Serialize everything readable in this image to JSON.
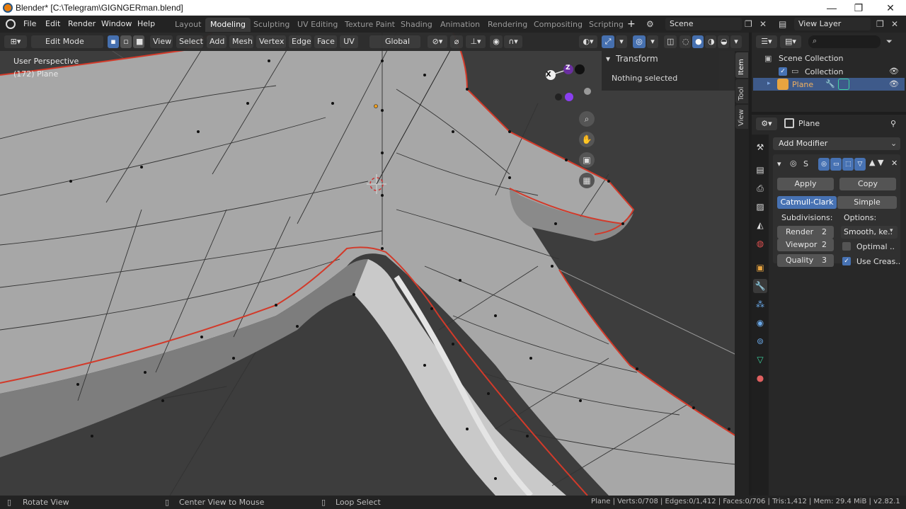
{
  "window": {
    "title": "Blender* [C:\\Telegram\\GIGNGERman.blend]",
    "minimize": "—",
    "maximize": "❐",
    "close": "✕"
  },
  "menu": [
    "File",
    "Edit",
    "Render",
    "Window",
    "Help"
  ],
  "workspaces": {
    "tabs": [
      "Layout",
      "Modeling",
      "Sculpting",
      "UV Editing",
      "Texture Paint",
      "Shading",
      "Animation",
      "Rendering",
      "Compositing",
      "Scripting"
    ],
    "active": "Modeling",
    "add": "+"
  },
  "scene": {
    "label": "Scene",
    "view_layer": "View Layer"
  },
  "viewport_header": {
    "mode": "Edit Mode",
    "menus": [
      "View",
      "Select",
      "Add",
      "Mesh",
      "Vertex",
      "Edge",
      "Face",
      "UV"
    ],
    "orientation": "Global"
  },
  "viewport": {
    "perspective": "User Perspective",
    "object_info": "(172) Plane",
    "gizmo_x": "X",
    "gizmo_z": "Z"
  },
  "n_panel": {
    "title": "Transform",
    "message": "Nothing selected",
    "tabs": [
      "Item",
      "Tool",
      "View"
    ]
  },
  "outliner": {
    "search_placeholder": "",
    "scene_collection": "Scene Collection",
    "collection": "Collection",
    "object": "Plane"
  },
  "properties": {
    "object_name": "Plane",
    "add_modifier": "Add Modifier",
    "modifier_name": "S",
    "apply": "Apply",
    "copy": "Copy",
    "mode_catmull": "Catmull-Clark",
    "mode_simple": "Simple",
    "subdivisions_label": "Subdivisions:",
    "options_label": "Options:",
    "render_label": "Render",
    "render_value": "2",
    "viewport_label": "Viewpor",
    "viewport_value": "2",
    "quality_label": "Quality",
    "quality_value": "3",
    "smooth_option": "Smooth, ke..",
    "optimal_label": "Optimal ..",
    "use_creases_label": "Use Creas.."
  },
  "statusbar": {
    "rotate": "Rotate View",
    "center": "Center View to Mouse",
    "loop": "Loop Select",
    "stats": "Plane | Verts:0/708 | Edges:0/1,412 | Faces:0/706 | Tris:1,412 | Mem: 29.4 MiB | v2.82.1"
  },
  "colors": {
    "accent": "#4772b3",
    "seam": "#d23a2a",
    "mesh": "#a9a9a9",
    "background": "#3d3d3d"
  }
}
